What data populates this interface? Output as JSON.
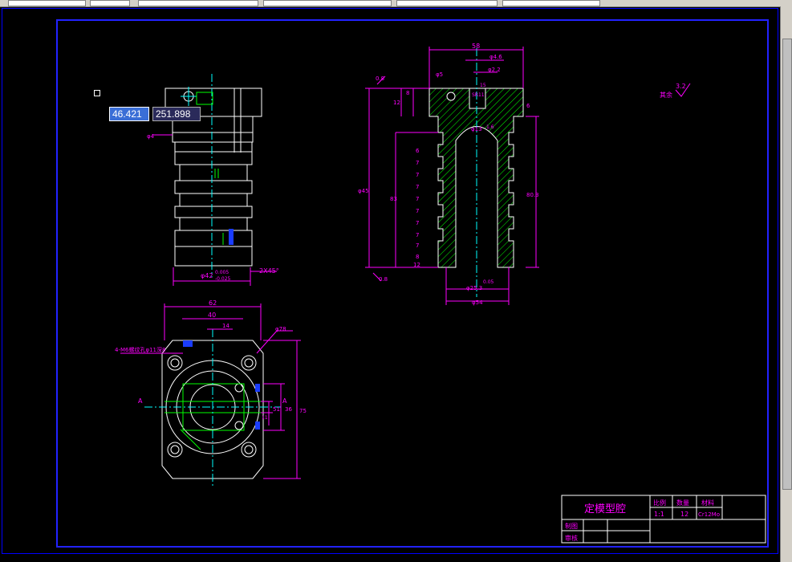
{
  "cursor_input": {
    "x_value": "46.421",
    "y_value": "251.898"
  },
  "dimensions": {
    "side_view": [
      "φ42",
      "0.005",
      "-0.025",
      "2X45°",
      "φ4"
    ],
    "section_view": [
      "58",
      "φ4.6",
      "φ2.2",
      "φ5",
      "0.8",
      "12",
      "8",
      "6",
      "83",
      "φ13",
      "15",
      "φ25.3",
      "1.6",
      "0.8",
      "80.3",
      "φ54",
      "SR11",
      "φ45",
      "0.05",
      "6",
      "7",
      "7",
      "7",
      "7",
      "7",
      "7",
      "7",
      "7",
      "8",
      "12"
    ],
    "plan_view": [
      "62",
      "40",
      "14",
      "φ78",
      "51",
      "36",
      "75",
      "11",
      "A",
      "A"
    ]
  },
  "labels": {
    "roughness_other": "其余",
    "roughness_value": "3.2",
    "hole_note": "4-M6螺纹孔φ11深8"
  },
  "title_block": {
    "part_name": "定模型腔",
    "scale_label": "比例",
    "scale_value": "1:1",
    "qty_label": "数量",
    "qty_value": "12",
    "material_label": "材料",
    "material_value": "Cr12Mo",
    "drawn_label": "制图",
    "checked_label": "审核"
  },
  "colors": {
    "outline": "#ffffff",
    "dimension": "#ff00ff",
    "centerline": "#00ffff",
    "hatch": "#00ff00",
    "frame": "#2222ff"
  }
}
